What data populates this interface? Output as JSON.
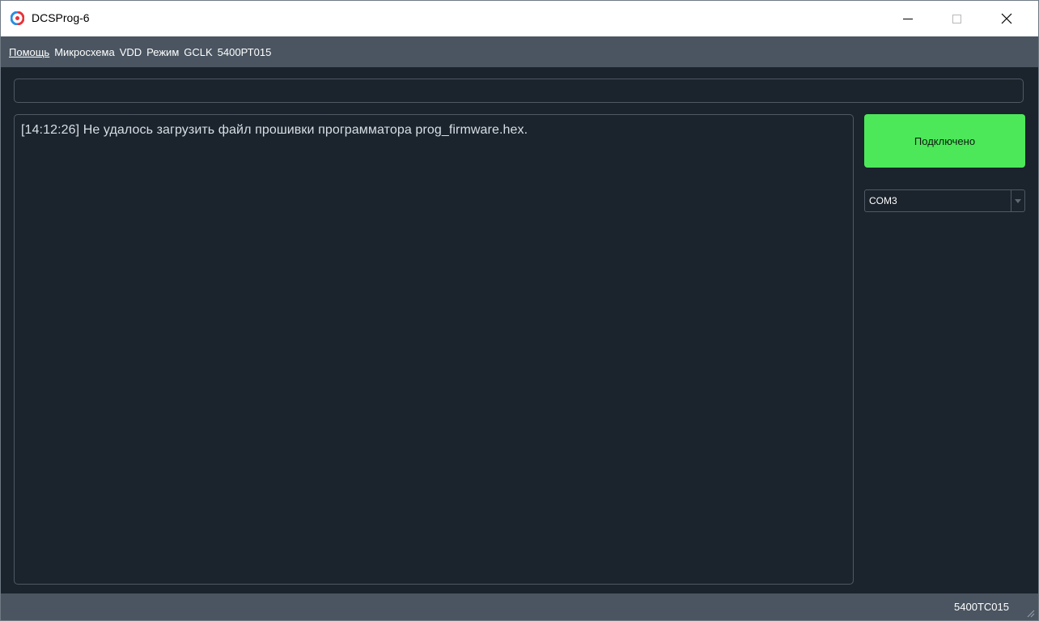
{
  "window": {
    "title": "DCSProg-6",
    "icon": "dcsprog-app-icon",
    "controls": {
      "minimize": "minimize-icon",
      "maximize": "maximize-icon",
      "close": "close-icon"
    }
  },
  "menu": {
    "items": [
      "Помощь",
      "Микросхема",
      "VDD",
      "Режим",
      "GCLK",
      "5400РТ015"
    ]
  },
  "top_field": {
    "value": ""
  },
  "log": {
    "lines": [
      "[14:12:26] Не удалось загрузить файл прошивки программатора prog_firmware.hex."
    ]
  },
  "connect_button": {
    "label": "Подключено",
    "color": "#4ce85a"
  },
  "port_select": {
    "value": "COM3"
  },
  "status_bar": {
    "text": "5400ТС015"
  },
  "colors": {
    "background": "#1b232c",
    "menubar": "#4a5561",
    "border": "#4f5a65"
  }
}
